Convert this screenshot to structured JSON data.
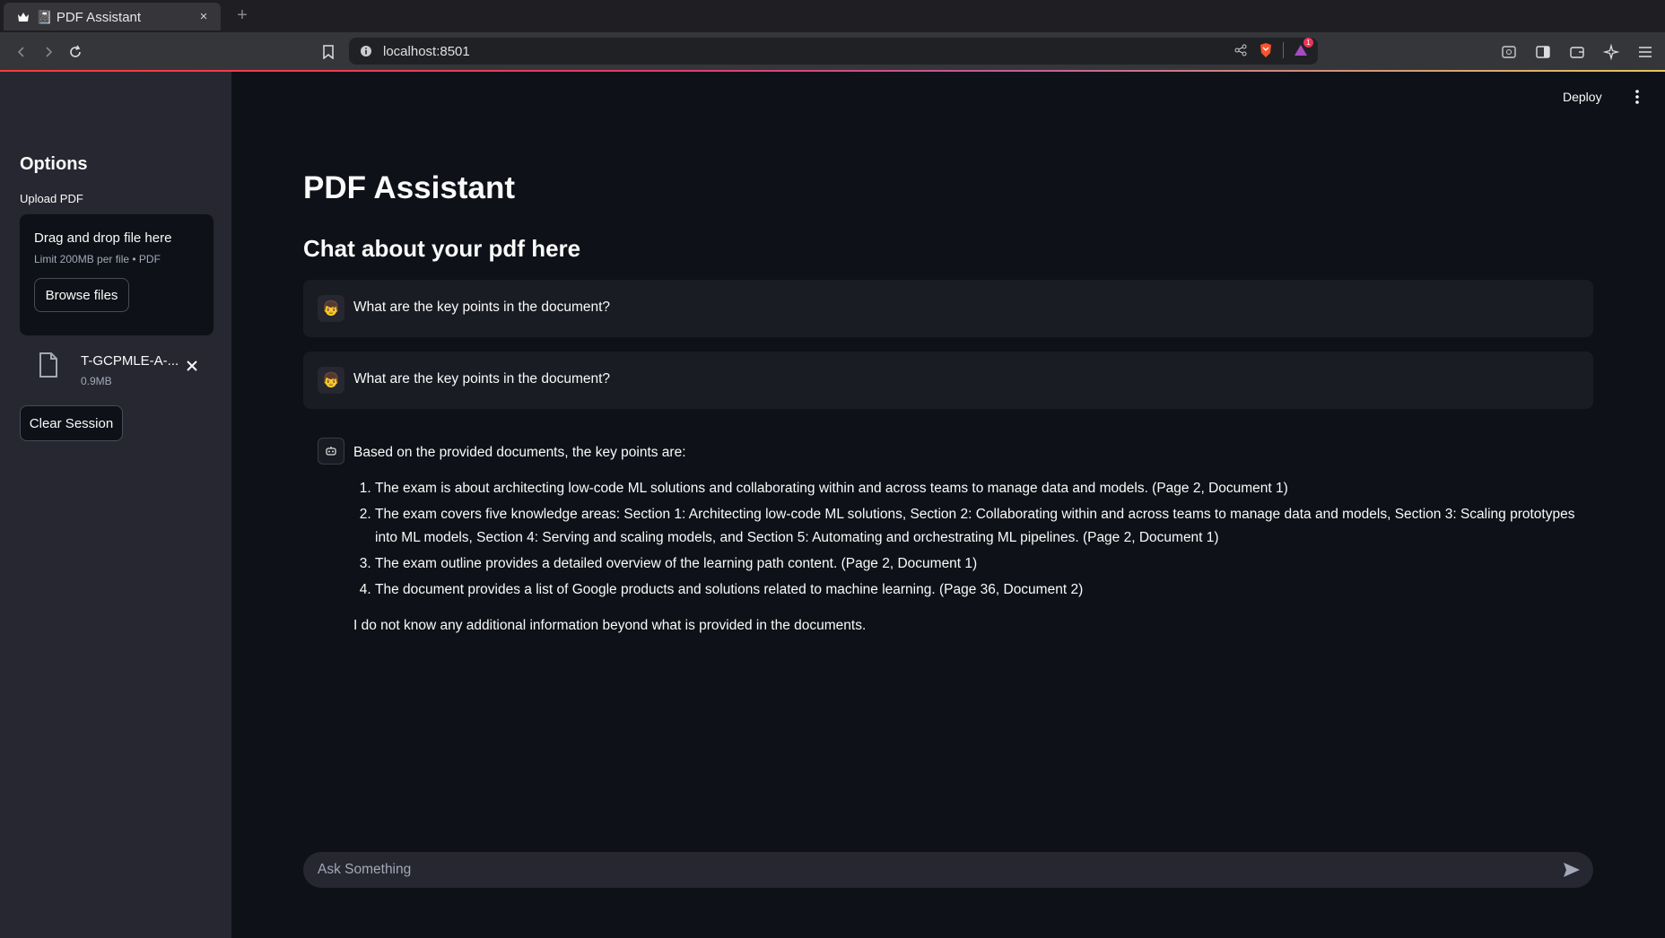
{
  "browser": {
    "tab_title": "📓 PDF Assistant",
    "tab_close": "×",
    "new_tab": "+",
    "url": "localhost:8501",
    "notification_count": "1"
  },
  "header": {
    "deploy_label": "Deploy"
  },
  "sidebar": {
    "title": "Options",
    "upload_label": "Upload PDF",
    "dropzone_title": "Drag and drop file here",
    "dropzone_limit": "Limit 200MB per file • PDF",
    "browse_label": "Browse files",
    "file": {
      "name": "T-GCPMLE-A-...",
      "size": "0.9MB"
    },
    "clear_label": "Clear Session"
  },
  "main": {
    "title": "PDF Assistant",
    "subtitle": "Chat about your pdf here",
    "messages": [
      {
        "role": "user",
        "avatar": "👦",
        "text": "What are the key points in the document?"
      },
      {
        "role": "user",
        "avatar": "👦",
        "text": "What are the key points in the document?"
      }
    ],
    "answer": {
      "intro": "Based on the provided documents, the key points are:",
      "points": [
        "The exam is about architecting low-code ML solutions and collaborating within and across teams to manage data and models. (Page 2, Document 1)",
        "The exam covers five knowledge areas: Section 1: Architecting low-code ML solutions, Section 2: Collaborating within and across teams to manage data and models, Section 3: Scaling prototypes into ML models, Section 4: Serving and scaling models, and Section 5: Automating and orchestrating ML pipelines. (Page 2, Document 1)",
        "The exam outline provides a detailed overview of the learning path content. (Page 2, Document 1)",
        "The document provides a list of Google products and solutions related to machine learning. (Page 36, Document 2)"
      ],
      "closing": "I do not know any additional information beyond what is provided in the documents."
    }
  },
  "chat_input": {
    "placeholder": "Ask Something"
  }
}
